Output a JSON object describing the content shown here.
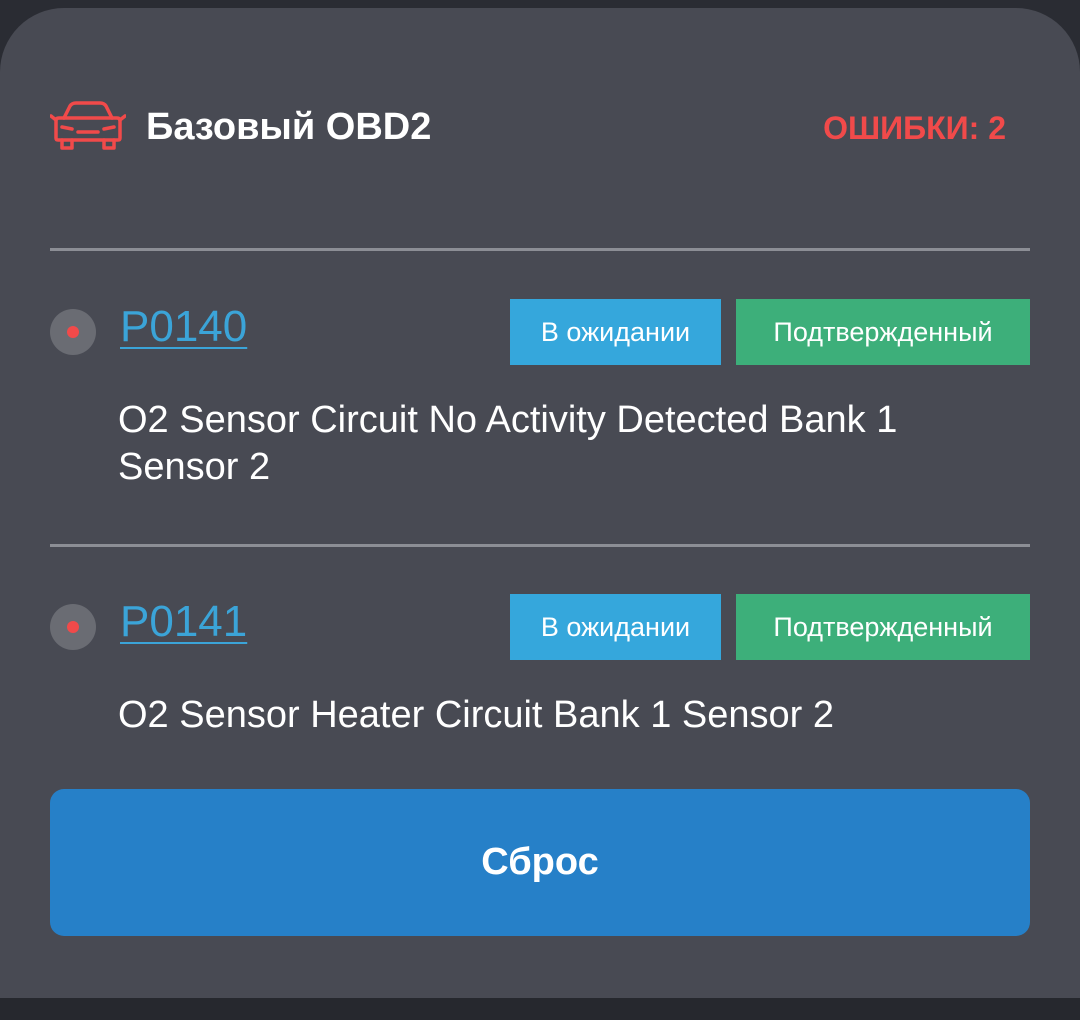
{
  "header": {
    "icon": "car-icon",
    "title": "Базовый OBD2",
    "errors": "ОШИБКИ: 2",
    "accent_color": "#f14a4a"
  },
  "codes": [
    {
      "code": "P0140",
      "status_pending": "В ожидании",
      "status_confirmed": "Подтвержденный",
      "description": "O2 Sensor Circuit No Activity Detected Bank 1 Sensor 2"
    },
    {
      "code": "P0141",
      "status_pending": "В ожидании",
      "status_confirmed": "Подтвержденный",
      "description": "O2 Sensor Heater Circuit Bank 1 Sensor 2"
    }
  ],
  "reset_button": {
    "label": "Сброс",
    "color": "#2680c8"
  }
}
